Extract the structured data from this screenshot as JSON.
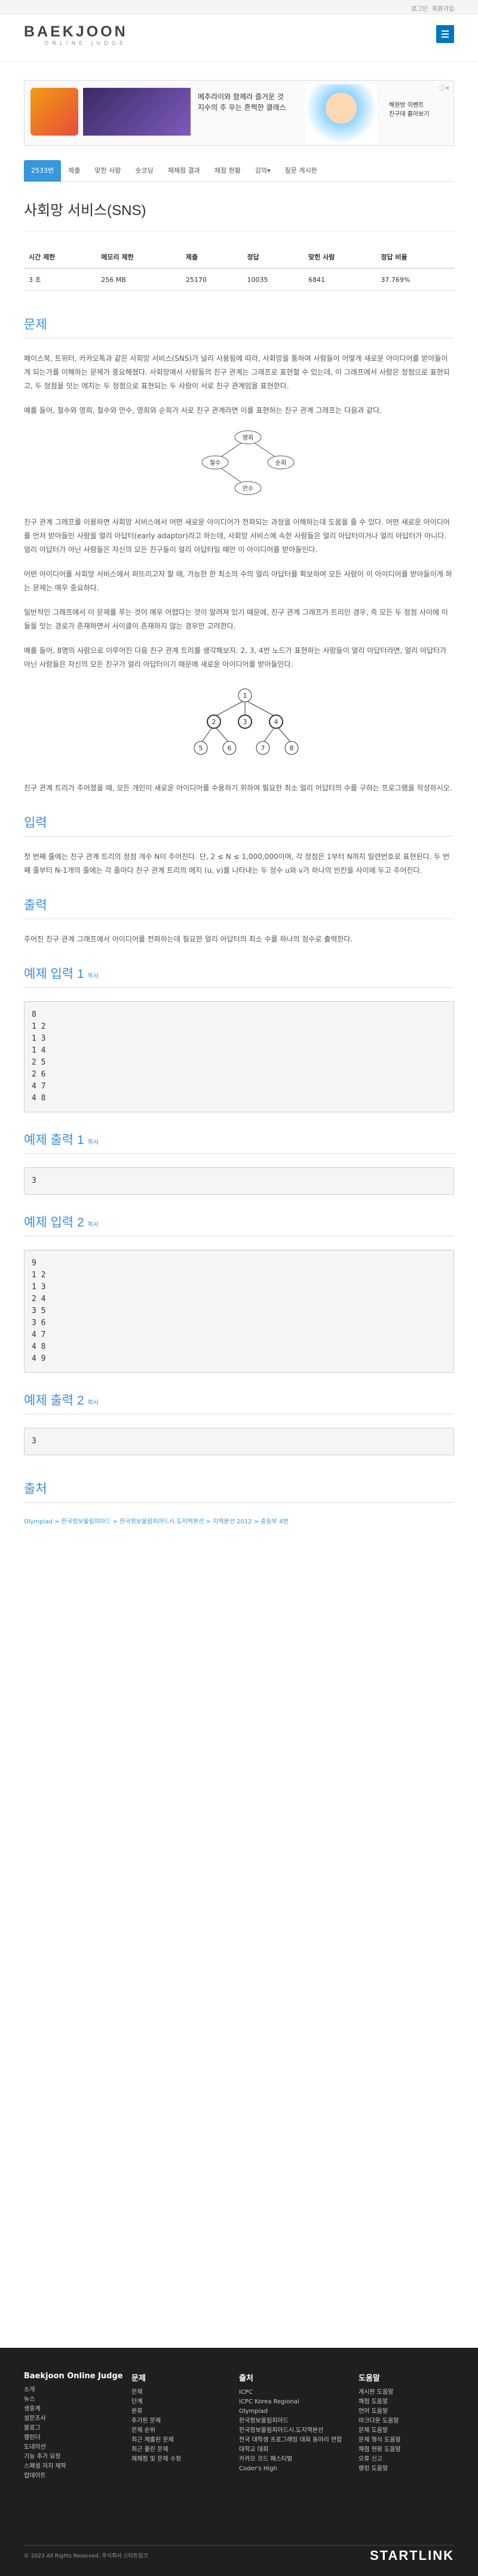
{
  "topbar": {
    "links": [
      "로그인",
      "회원가입"
    ]
  },
  "logo": {
    "main": "BAEKJOON",
    "sub": "ONLINE JUDGE"
  },
  "ad": {
    "line1": "메추라이와 함께라 즐거운 것",
    "line2": "지수의 주 우는 흔쩍한 클래스",
    "cta1": "해원방 이벤트",
    "cta2": "친구데 흘아보기"
  },
  "tabs": [
    "2533번",
    "제출",
    "맞힌 사람",
    "숏코딩",
    "재채점 결과",
    "채점 현황",
    "강의▾",
    "질문 게시판"
  ],
  "problem": {
    "title": "사회망 서비스(SNS)",
    "headers": [
      "시간 제한",
      "메모리 제한",
      "제출",
      "정답",
      "맞힌 사람",
      "정답 비율"
    ],
    "values": [
      "3 초",
      "256 MB",
      "25170",
      "10035",
      "6841",
      "37.769%"
    ]
  },
  "sections": {
    "problem": "문제",
    "input": "입력",
    "output": "출력",
    "sample_in_1": "예제 입력 1",
    "sample_out_1": "예제 출력 1",
    "sample_in_2": "예제 입력 2",
    "sample_out_2": "예제 출력 2",
    "source": "출처",
    "copy": "복사"
  },
  "text": {
    "p1": "페이스북, 트위터, 카카오톡과 같은 사회망 서비스(SNS)가 널리 사용됨에 따라, 사회망을 통하여 사람들이 어떻게 새로운 아이디어를 받아들이게 되는가를 이해하는 문제가 중요해졌다. 사회망에서 사람들의 친구 관계는 그래프로 표현할 수 있는데,  이 그래프에서 사람은 정점으로 표현되고, 두 정점을 잇는 에지는 두 정점으로 표현되는 두 사람이 서로 친구 관계임을 표현한다.",
    "p2": "예를 들어, 철수와 영희, 철수와 만수, 영희와 순희가 서로 친구 관계라면 이를 표현하는 친구 관계 그래프는 다음과 같다.",
    "p3": "친구 관계 그래프를 이용하면 사회망 서비스에서 어떤 새로운 아이디어가 전파되는 과정을 이해하는데 도움을 줄 수 있다. 어떤 새로운 아이디어를 먼저 받아들인 사람을 얼리 아답터(early adaptor)라고 하는데, 사회망 서비스에 속한 사람들은 얼리 아답터이거나 얼리 아답터가 아니다. 얼리 아답터가 아닌 사람들은 자신의 모든 친구들이 얼리 아답터일 때만 이 아이디어를 받아들인다.",
    "p4": "어떤 아이디어를 사회망 서비스에서 퍼뜨리고자 할 때, 가능한 한 최소의 수의 얼리 아답터를 확보하여 모든 사람이 이 아이디어를 받아들이게 하는  문제는 매우 중요하다.",
    "p5": "일반적인 그래프에서 이 문제를 푸는 것이 매우 어렵다는 것이 알려져 있기 때문에, 친구 관계 그래프가 트리인 경우, 즉 모든 두 정점 사이에 이들을 잇는 경로가 존재하면서 사이클이 존재하지 않는 경우만 고려한다.",
    "p6": "예를 들어, 8명의 사람으로 이루어진 다음 친구 관계 트리를 생각해보자. 2, 3, 4번 노드가 표현하는 사람들이 얼리 아답터라면, 얼리 아답터가 아닌 사람들은 자신의 모든 친구가 얼리 아답터이기 때문에 새로운 아이디어를 받아들인다.",
    "p7": "친구 관계 트리가 주어졌을 때, 모든 개인이 새로운 아이디어를 수용하기 위하여 필요한 최소 얼리 어답터의 수를 구하는 프로그램을 작성하시오.",
    "input": "첫 번째 줄에는 친구 관계 트리의 정점 개수 N이 주어진다. 단, 2 ≤ N ≤ 1,000,000이며, 각 정점은 1부터 N까지 일련번호로 표현된다. 두 번째 줄부터 N-1개의 줄에는 각 줄마다 친구 관계 트리의 에지 (u, v)를 나타내는 두 정수 u와 v가 하나의 빈칸을 사이에 두고 주어진다.",
    "output": "주어진 친구 관계 그래프에서 아이디어를 전파하는데 필요한 얼리 아답터의 최소 수를 하나의 정수로 출력한다."
  },
  "graph1": {
    "nodes": [
      "영희",
      "철수",
      "순희",
      "만수"
    ]
  },
  "graph2": {
    "nodes": [
      "1",
      "2",
      "3",
      "4",
      "5",
      "6",
      "7",
      "8"
    ]
  },
  "samples": {
    "in1": "8\n1 2\n1 3\n1 4\n2 5\n2 6\n4 7\n4 8",
    "out1": "3",
    "in2": "9\n1 2\n1 3\n2 4\n3 5\n3 6\n4 7\n4 8\n4 9",
    "out2": "3"
  },
  "source": "Olympiad > 한국정보올림피아드 > 한국정보올림피아드시.도지역본선 > 지역본선 2012 > 중등부 4번",
  "footer": {
    "cols": [
      {
        "title": "Baekjoon Online Judge",
        "items": [
          "소개",
          "뉴스",
          "생중계",
          "설문조사",
          "블로그",
          "캘린더",
          "도네이션",
          "기능 추가 요청",
          "스페셜 저지 제작",
          "업데이트"
        ]
      },
      {
        "title": "문제",
        "items": [
          "문제",
          "단계",
          "분류",
          "추가된 문제",
          "문제 순위",
          "최근 제출된 문제",
          "최근 풀린 문제",
          "재채점 및 문제 수정"
        ]
      },
      {
        "title": "출처",
        "items": [
          "ICPC",
          "ICPC Korea Regional",
          "Olympiad",
          "한국정보올림피아드",
          "한국정보올림피아드시.도지역본선",
          "전국 대학생 프로그래밍 대회 동아리 연합",
          "대학교 대회",
          "카카오 코드 페스티벌",
          "Coder's High"
        ]
      },
      {
        "title": "도움말",
        "items": [
          "게시판 도움말",
          "채점 도움말",
          "언어 도움말",
          "마크다운 도움말",
          "문제 도움말",
          "문제 형식 도움말",
          "채점 현황 도움말",
          "오류 신고",
          "랭킹 도움말"
        ]
      }
    ],
    "copyright": "© 2023 All Rights Reserved. 주식회사 스타트링크",
    "brand": "STARTLINK"
  }
}
